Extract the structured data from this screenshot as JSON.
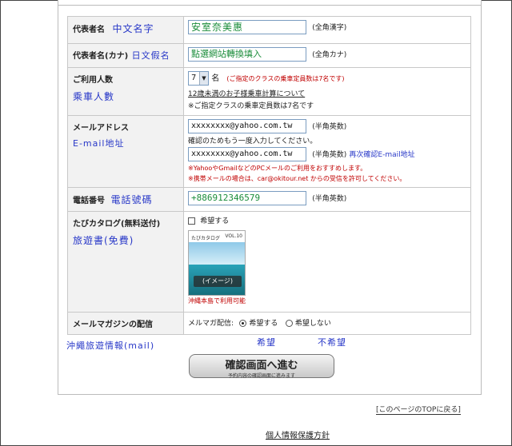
{
  "rows": {
    "name": {
      "label": "代表者名",
      "annot": "中文名字",
      "value": "安室奈美惠",
      "hint": "(全角漢字)"
    },
    "name_kana": {
      "label": "代表者名(カナ)",
      "annot": "日文假名",
      "value": "點選網站轉換填入",
      "hint": "(全角カナ)"
    },
    "people": {
      "label": "ご利用人数",
      "annot": "乘車人數",
      "value": "7",
      "unit": "名",
      "note_red": "(ご指定のクラスの乗車定員数は7名です)",
      "link": "12歳未満のお子様乗車計算について",
      "note": "※ご指定クラスの乗車定員数は7名です"
    },
    "email": {
      "label": "メールアドレス",
      "annot": "E-mail地址",
      "value": "xxxxxxxx@yahoo.com.tw",
      "hint": "(半角英数)",
      "confirm_text": "確認のためもう一度入力してください。",
      "confirm_value": "xxxxxxxx@yahoo.com.tw",
      "confirm_hint": "(半角英数)",
      "confirm_annot": "再次確認E-mail地址",
      "warn1": "※YahooやGmailなどのPCメールのご利用をおすすめします。",
      "warn2": "※携帯メールの場合は、car@okitour.net からの受信を許可してください。"
    },
    "phone": {
      "label": "電話番号",
      "annot": "電話號碼",
      "value": "+886912346579",
      "hint": "(半角英数)"
    },
    "catalog": {
      "label": "たびカタログ(無料送付)",
      "annot": "旅遊書(免費)",
      "checkbox_label": "希望する",
      "cover_title": "たびカタログ",
      "cover_vol": "VOL.10",
      "image_label": "(イメージ)",
      "caption": "沖縄本島で利用可能"
    },
    "magazine": {
      "label": "メールマガジンの配信",
      "prefix": "メルマガ配信:",
      "opt_yes": "希望する",
      "opt_no": "希望しない",
      "selected": "yes"
    }
  },
  "annotations": {
    "magazine": "沖繩旅遊情報(mail)",
    "yes": "希望",
    "no": "不希望"
  },
  "buttons": {
    "confirm_main": "確認画面へ進む",
    "confirm_sub": "予約内容の確認画面に進みます"
  },
  "footer": {
    "top_link": "[このページのTOPに戻る]",
    "privacy": "個人情報保護方針"
  },
  "colors": {
    "annotation_blue": "#2838c8",
    "input_green": "#1a8c3a",
    "warning_red": "#c00000"
  }
}
